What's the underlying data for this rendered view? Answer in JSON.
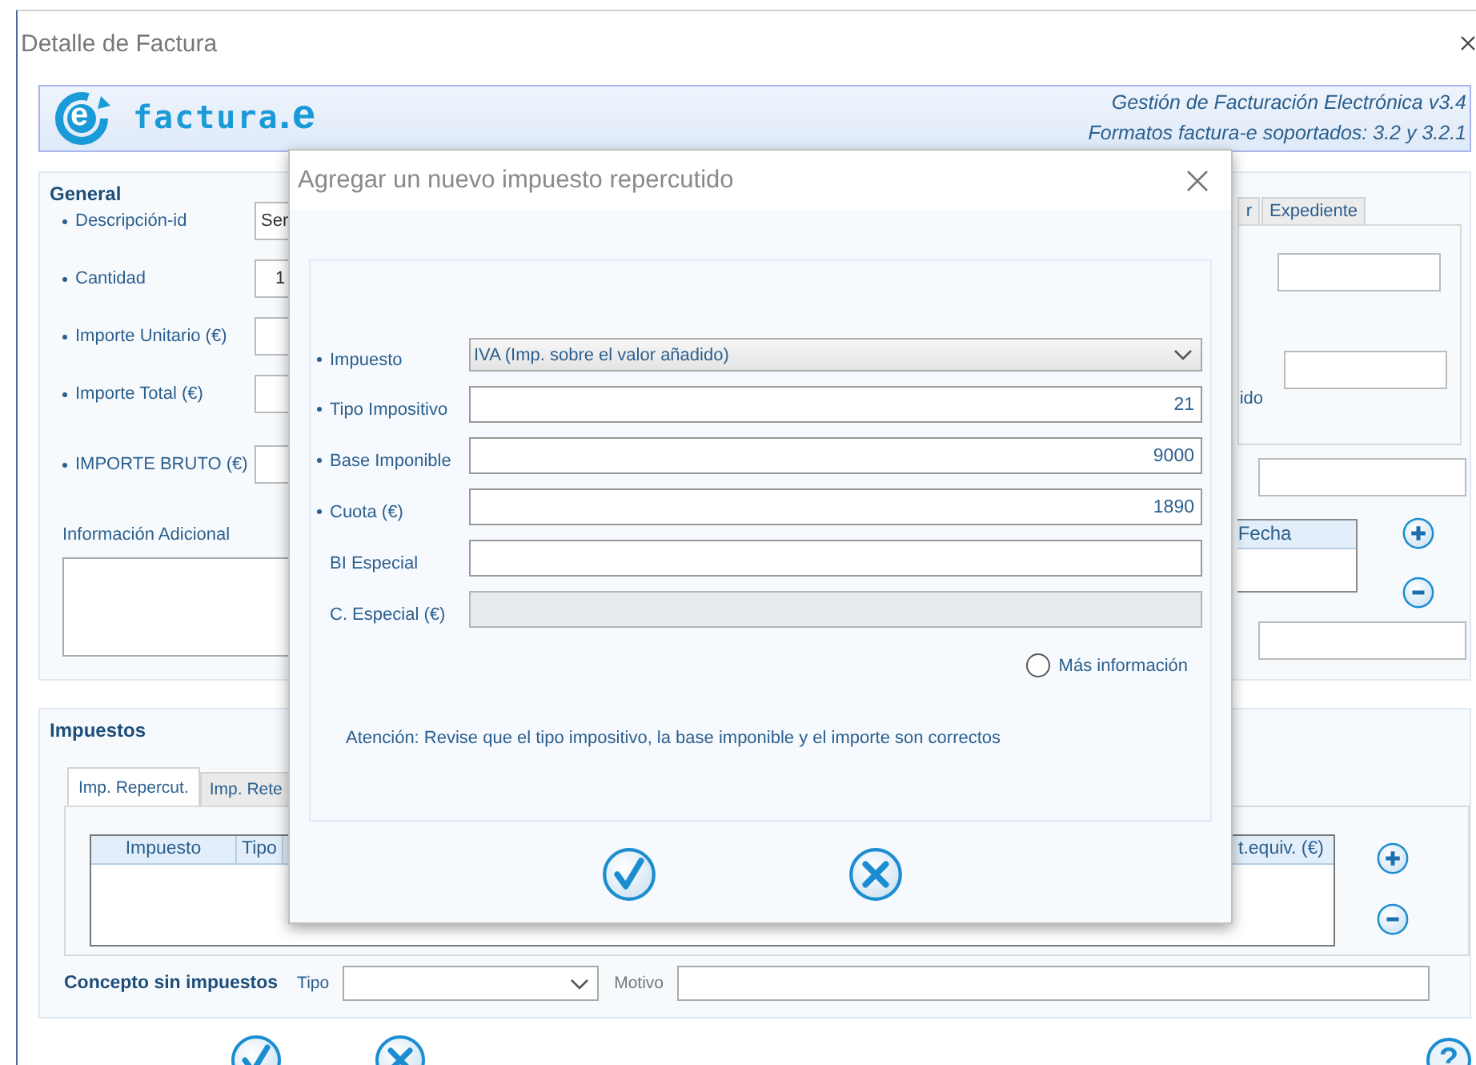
{
  "window": {
    "title": "Detalle de Factura"
  },
  "header": {
    "logo_letter": "e",
    "brand": "factura",
    "brand_suffix": ".e",
    "app_name": "Gestión de Facturación Electrónica v3.4",
    "formats": "Formatos factura-e soportados: 3.2 y 3.2.1"
  },
  "general": {
    "title": "General",
    "fields": [
      {
        "label": "Descripción-id",
        "required": true,
        "value": "Ser"
      },
      {
        "label": "Cantidad",
        "required": true,
        "value": "1"
      },
      {
        "label": "Importe Unitario (€)",
        "required": true
      },
      {
        "label": "Importe Total (€)",
        "required": true
      },
      {
        "label": "IMPORTE BRUTO (€)",
        "required": true
      }
    ],
    "info_label": "Información Adicional",
    "side_tabs": [
      {
        "label": "r",
        "selected": false
      },
      {
        "label": "Expediente",
        "selected": false
      }
    ],
    "side_label": "ido",
    "date_column": "Fecha"
  },
  "impuestos": {
    "title": "Impuestos",
    "tabs": [
      {
        "label": "Imp. Repercut.",
        "selected": true
      },
      {
        "label": "Imp. Rete",
        "selected": false
      }
    ],
    "columns": [
      "Impuesto",
      "Tipo",
      "t.equiv. (€)"
    ]
  },
  "concepto": {
    "label": "Concepto sin impuestos",
    "tipo_label": "Tipo",
    "motivo_label": "Motivo"
  },
  "help_label": "?",
  "dialog": {
    "title": "Agregar un nuevo impuesto repercutido",
    "fields": [
      {
        "kind": "select",
        "label": "Impuesto",
        "required": true,
        "disabled": false,
        "value": "IVA (Imp. sobre el valor añadido)"
      },
      {
        "kind": "text",
        "label": "Tipo Impositivo",
        "required": true,
        "disabled": false,
        "value": "21"
      },
      {
        "kind": "text",
        "label": "Base Imponible",
        "required": true,
        "disabled": false,
        "value": "9000"
      },
      {
        "kind": "text",
        "label": "Cuota (€)",
        "required": true,
        "disabled": false,
        "value": "1890"
      },
      {
        "kind": "text",
        "label": "BI Especial",
        "required": false,
        "disabled": false
      },
      {
        "kind": "text",
        "label": "C. Especial (€)",
        "required": false,
        "disabled": true
      }
    ],
    "more_info": {
      "label": "Más información",
      "checked": false
    },
    "notice": "Atención: Revise que el tipo impositivo, la base imponible y el importe son correctos"
  }
}
